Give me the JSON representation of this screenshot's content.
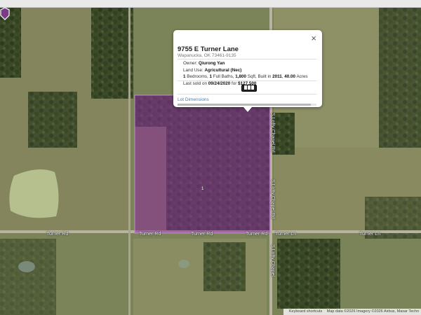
{
  "popup": {
    "close_icon": "×",
    "address": "9755 E Turner Lane",
    "city_state_zip": "Wapanucka, OK 73461-9135",
    "owner_label": "Owner:",
    "owner_value": "Qiurong Yan",
    "land_use_label": "Land Use:",
    "land_use_value": "Agricultural (Nec)",
    "bedrooms": "1",
    "bedrooms_label": "Bedrooms,",
    "baths": "1",
    "baths_label": "Full Baths,",
    "sqft": "1,800",
    "sqft_label": "Sqft, Built in",
    "year_built": "2011",
    "acres": "40.00",
    "acres_label": "Acres",
    "last_sold_label": "Last sold on",
    "last_sold_date": "09/24/2020",
    "last_sold_for": "for",
    "last_sold_price": "$127,500",
    "lot_dimensions_link": "Lot Dimensions"
  },
  "map": {
    "marker_label": "1",
    "parcel_color": "#8b2f9c",
    "road_labels": {
      "turner_rd_left": "Turner Rd",
      "turner_rd_mid1": "Turner Rd",
      "turner_rd_mid2": "Turner Rd",
      "turner_rd_mid3": "Turner Rd",
      "turner_ln_1": "Turner Ln",
      "turner_ln_2": "Turner Ln",
      "chapel_top": "S Lofty Chapel Rd",
      "chapel_mid": "S Lofty Chapel Rd",
      "chapel_bottom": "S Lofty Chapel"
    }
  },
  "attribution": {
    "keyboard": "Keyboard shortcuts",
    "map_data": "Map data ©2026 Imagery ©2026 Airbus, Maxar Techn"
  }
}
